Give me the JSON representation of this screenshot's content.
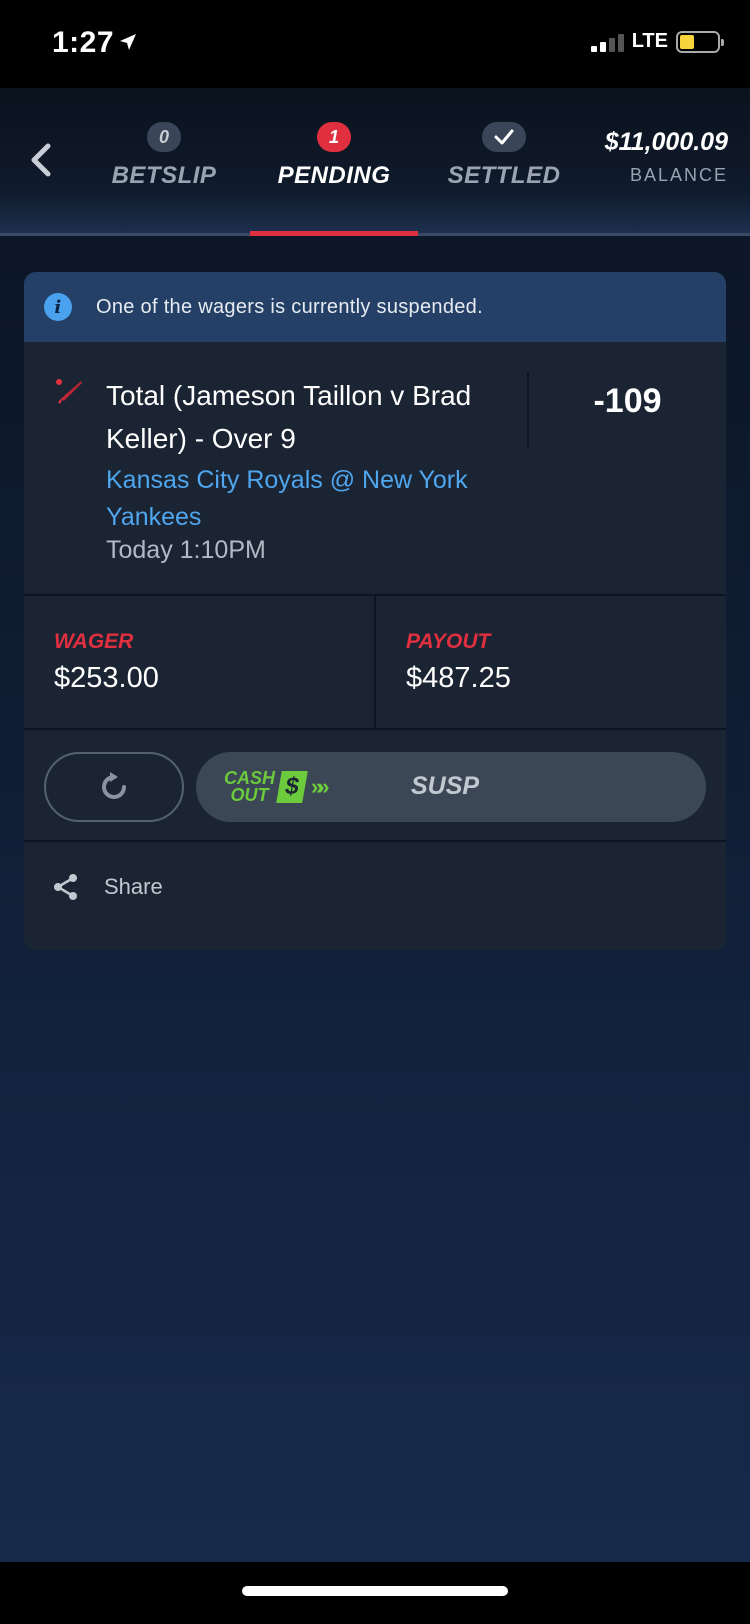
{
  "status_bar": {
    "time": "1:27",
    "carrier": "LTE"
  },
  "nav": {
    "tabs": [
      {
        "badge": "0",
        "label": "BETSLIP"
      },
      {
        "badge": "1",
        "label": "PENDING"
      },
      {
        "badge": "check-icon",
        "label": "SETTLED"
      }
    ],
    "balance": {
      "amount": "$11,000.09",
      "label": "BALANCE"
    }
  },
  "notice": {
    "text": "One of the wagers is currently suspended."
  },
  "bet": {
    "title": "Total (Jameson Taillon v Brad Keller) - Over 9",
    "matchup": "Kansas City Royals @ New York Yankees",
    "time": "Today 1:10PM",
    "odds": "-109",
    "sport_icon": "baseball-bat-icon"
  },
  "amounts": {
    "wager_label": "WAGER",
    "wager_value": "$253.00",
    "payout_label": "PAYOUT",
    "payout_value": "$487.25"
  },
  "actions": {
    "cashout_line1": "CASH",
    "cashout_line2": "OUT",
    "cashout_symbol": "$",
    "cashout_status": "SUSP"
  },
  "share": {
    "label": "Share"
  },
  "colors": {
    "accent_red": "#e03040",
    "link_blue": "#4fa6ee",
    "cashout_green": "#6ccb3c",
    "notice_bg": "#254066"
  }
}
